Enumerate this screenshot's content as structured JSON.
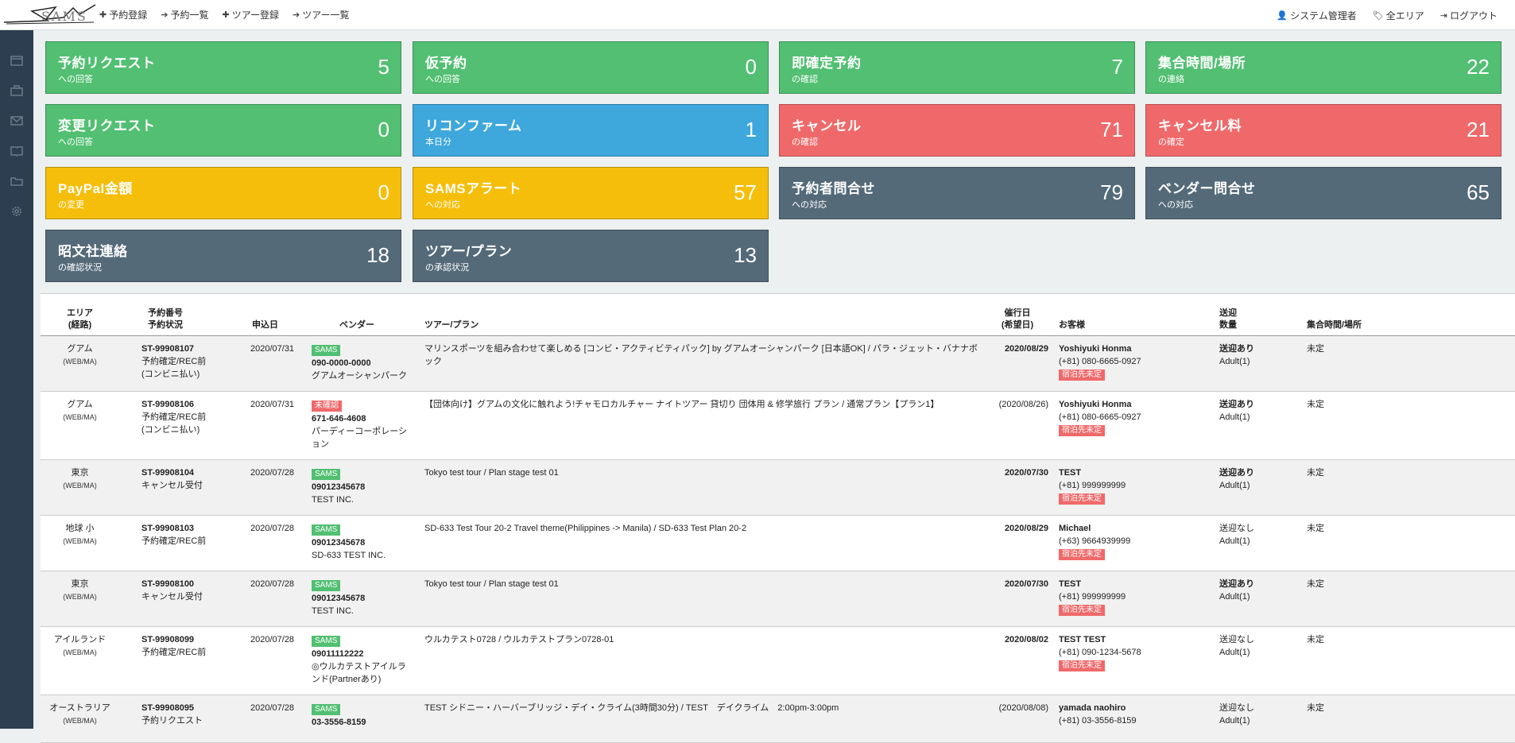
{
  "nav": {
    "items": [
      {
        "icon": "plus-icon",
        "glyph": "✚",
        "label": "予約登録"
      },
      {
        "icon": "arrow-right-icon",
        "glyph": "➔",
        "label": "予約一覧"
      },
      {
        "icon": "plus-icon",
        "glyph": "✚",
        "label": "ツアー登録"
      },
      {
        "icon": "arrow-right-icon",
        "glyph": "➔",
        "label": "ツアー一覧"
      }
    ],
    "user": "システム管理者",
    "area": "全エリア",
    "logout": "ログアウト"
  },
  "sidebar": {
    "icons": [
      "calendar-icon",
      "briefcase-icon",
      "mail-icon",
      "book-icon",
      "folder-icon",
      "gear-icon"
    ]
  },
  "tiles": [
    {
      "title": "予約リクエスト",
      "subtitle": "への回答",
      "count": "5",
      "color": "#52bf72"
    },
    {
      "title": "仮予約",
      "subtitle": "への回答",
      "count": "0",
      "color": "#52bf72"
    },
    {
      "title": "即確定予約",
      "subtitle": "の確認",
      "count": "7",
      "color": "#52bf72"
    },
    {
      "title": "集合時間/場所",
      "subtitle": "の連絡",
      "count": "22",
      "color": "#52bf72"
    },
    {
      "title": "変更リクエスト",
      "subtitle": "への回答",
      "count": "0",
      "color": "#52bf72"
    },
    {
      "title": "リコンファーム",
      "subtitle": "本日分",
      "count": "1",
      "color": "#3ea7dc"
    },
    {
      "title": "キャンセル",
      "subtitle": "の確認",
      "count": "71",
      "color": "#f0696a"
    },
    {
      "title": "キャンセル料",
      "subtitle": "の確定",
      "count": "21",
      "color": "#f0696a"
    },
    {
      "title": "PayPal金額",
      "subtitle": "の変更",
      "count": "0",
      "color": "#f5be0a"
    },
    {
      "title": "SAMSアラート",
      "subtitle": "への対応",
      "count": "57",
      "color": "#f5be0a"
    },
    {
      "title": "予約者問合せ",
      "subtitle": "への対応",
      "count": "79",
      "color": "#546a79"
    },
    {
      "title": "ベンダー問合せ",
      "subtitle": "への対応",
      "count": "65",
      "color": "#546a79"
    },
    {
      "title": "昭文社連絡",
      "subtitle": "の確認状況",
      "count": "18",
      "color": "#546a79"
    },
    {
      "title": "ツアー/プラン",
      "subtitle": "の承認状況",
      "count": "13",
      "color": "#546a79"
    }
  ],
  "table": {
    "headers": {
      "area1": "エリア",
      "area2": "(経路)",
      "resno1": "予約番号",
      "resno2": "予約状況",
      "applied": "申込日",
      "vendor": "ベンダー",
      "tour": "ツアー/プラン",
      "date1": "催行日",
      "date2": "(希望日)",
      "customer": "お客様",
      "pickup1": "送迎",
      "pickup2": "数量",
      "meeting": "集合時間/場所"
    },
    "rows": [
      {
        "area": "グアム",
        "route": "(WEB/MA)",
        "id": "ST-99908107",
        "status": "予約確定/REC前",
        "status2": "(コンビニ払い)",
        "applied": "2020/07/31",
        "vbadge": "SAMS",
        "vcolor": "green",
        "vphone": "090-0000-0000",
        "vname": "グアムオーシャンパーク",
        "tour": "マリンスポーツを組み合わせて楽しめる [コンビ・アクティビティパック] by グアムオーシャンパーク [日本語OK] / パラ・ジェット・バナナボック",
        "date": "2020/08/29",
        "dateBold": true,
        "cname": "Yoshiyuki Honma",
        "cphone": "(+81) 080-6665-0927",
        "hotel": "宿泊先未定",
        "pickup": "送迎あり",
        "pickupBold": true,
        "qty": "Adult(1)",
        "meeting": "未定"
      },
      {
        "area": "グアム",
        "route": "(WEB/MA)",
        "id": "ST-99908106",
        "status": "予約確定/REC前",
        "status2": "(コンビニ払い)",
        "applied": "2020/07/31",
        "vbadge": "未確認",
        "vcolor": "red",
        "vphone": "671-646-4608",
        "vname": "パーディーコーポレーション",
        "tour": "【団体向け】グアムの文化に触れよう!チャモロカルチャー ナイトツアー 貸切り 団体用 & 修学旅行 プラン / 通常プラン【プラン1】",
        "date": "(2020/08/26)",
        "dateBold": false,
        "cname": "Yoshiyuki Honma",
        "cphone": "(+81) 080-6665-0927",
        "hotel": "宿泊先未定",
        "pickup": "送迎あり",
        "pickupBold": true,
        "qty": "Adult(1)",
        "meeting": "未定"
      },
      {
        "area": "東京",
        "route": "(WEB/MA)",
        "id": "ST-99908104",
        "status": "キャンセル受付",
        "status2": "",
        "applied": "2020/07/28",
        "vbadge": "SAMS",
        "vcolor": "green",
        "vphone": "09012345678",
        "vname": "TEST INC.",
        "tour": "Tokyo test tour / Plan stage test 01",
        "date": "2020/07/30",
        "dateBold": true,
        "cname": "TEST",
        "cphone": "(+81) 999999999",
        "hotel": "宿泊先未定",
        "pickup": "送迎あり",
        "pickupBold": true,
        "qty": "Adult(1)",
        "meeting": "未定"
      },
      {
        "area": "地球 小",
        "route": "(WEB/MA)",
        "id": "ST-99908103",
        "status": "予約確定/REC前",
        "status2": "",
        "applied": "2020/07/28",
        "vbadge": "SAMS",
        "vcolor": "green",
        "vphone": "09012345678",
        "vname": "SD-633 TEST INC.",
        "tour": "SD-633 Test Tour 20-2 Travel theme(Philippines -> Manila) / SD-633 Test Plan 20-2",
        "date": "2020/08/29",
        "dateBold": true,
        "cname": "Michael",
        "cphone": "(+63) 9664939999",
        "hotel": "宿泊先未定",
        "pickup": "送迎なし",
        "pickupBold": false,
        "qty": "Adult(1)",
        "meeting": "未定"
      },
      {
        "area": "東京",
        "route": "(WEB/MA)",
        "id": "ST-99908100",
        "status": "キャンセル受付",
        "status2": "",
        "applied": "2020/07/28",
        "vbadge": "SAMS",
        "vcolor": "green",
        "vphone": "09012345678",
        "vname": "TEST INC.",
        "tour": "Tokyo test tour / Plan stage test 01",
        "date": "2020/07/30",
        "dateBold": true,
        "cname": "TEST",
        "cphone": "(+81) 999999999",
        "hotel": "宿泊先未定",
        "pickup": "送迎あり",
        "pickupBold": true,
        "qty": "Adult(1)",
        "meeting": "未定"
      },
      {
        "area": "アイルランド",
        "route": "(WEB/MA)",
        "id": "ST-99908099",
        "status": "予約確定/REC前",
        "status2": "",
        "applied": "2020/07/28",
        "vbadge": "SAMS",
        "vcolor": "green",
        "vphone": "09011112222",
        "vname": "◎ウルカテストアイルランド(Partnerあり)",
        "tour": "ウルカテスト0728 / ウルカテストプラン0728-01",
        "date": "2020/08/02",
        "dateBold": true,
        "cname": "TEST TEST",
        "cphone": "(+81) 090-1234-5678",
        "hotel": "宿泊先未定",
        "pickup": "送迎なし",
        "pickupBold": false,
        "qty": "Adult(1)",
        "meeting": "未定"
      },
      {
        "area": "オーストラリア",
        "route": "(WEB/MA)",
        "id": "ST-99908095",
        "status": "予約リクエスト",
        "status2": "",
        "applied": "2020/07/28",
        "vbadge": "SAMS",
        "vcolor": "green",
        "vphone": "03-3556-8159",
        "vname": "",
        "tour": "TEST シドニー・ハーバーブリッジ・デイ・クライム(3時間30分) / TEST　デイクライム　2:00pm-3:00pm",
        "date": "(2020/08/08)",
        "dateBold": false,
        "cname": "yamada naohiro",
        "cphone": "(+81) 03-3556-8159",
        "hotel": "",
        "pickup": "送迎なし",
        "pickupBold": false,
        "qty": "Adult(1)",
        "meeting": "未定"
      }
    ]
  }
}
